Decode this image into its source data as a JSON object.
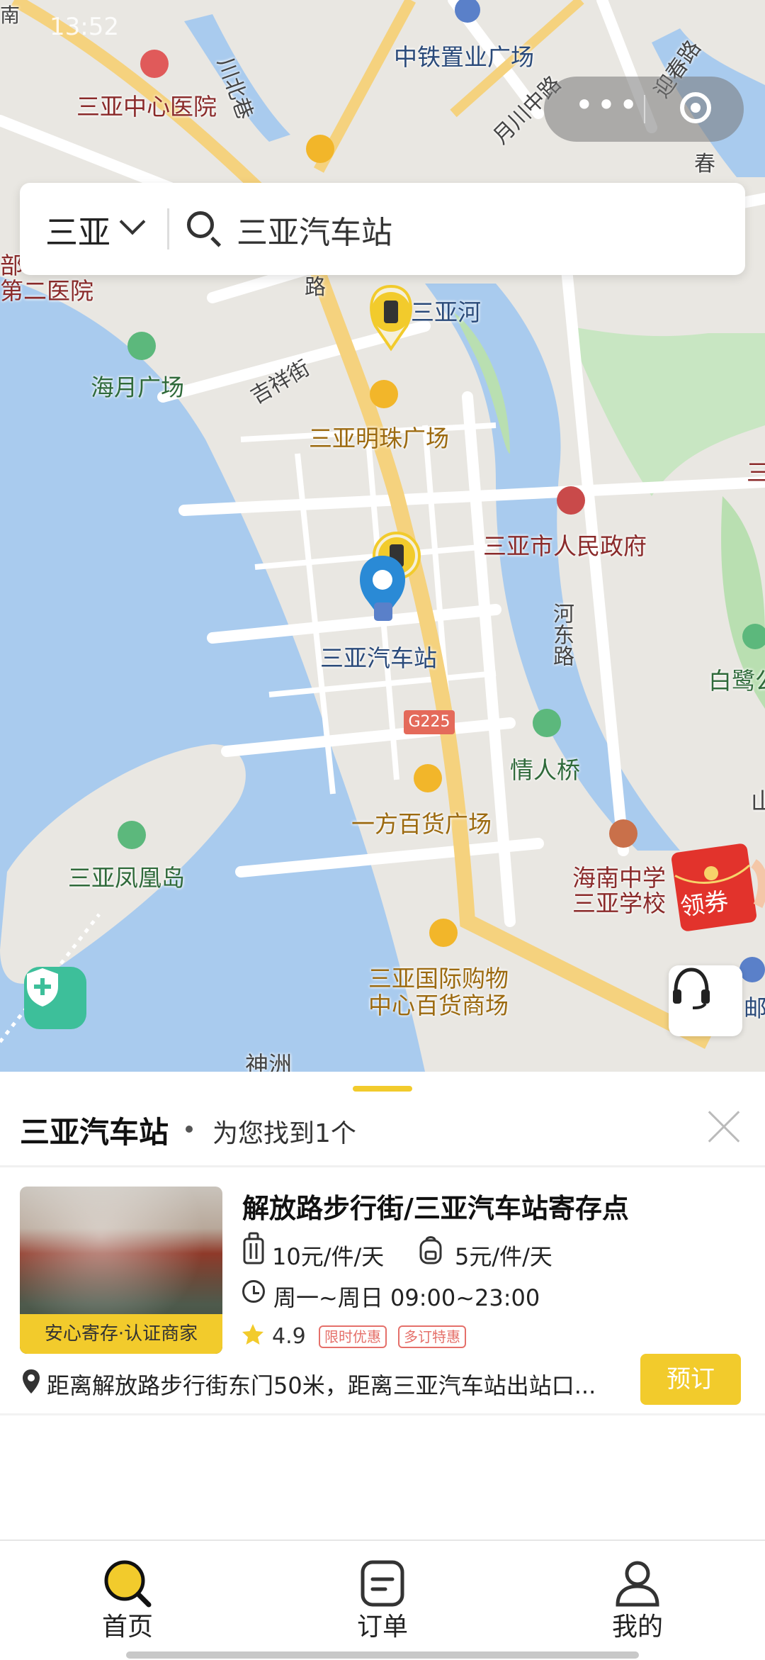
{
  "status_bar": {
    "time": "13:52"
  },
  "mini_program": {
    "more_label": "•••"
  },
  "search": {
    "city": "三亚",
    "query": "三亚汽车站"
  },
  "map": {
    "labels": {
      "zhongtie": "中铁置业广场",
      "hospital_center": "三亚中心医院",
      "hospital_second_a": "部",
      "hospital_second_b": "第二医院",
      "chuanbei": "川北巷",
      "yuechuan": "月川中路",
      "yingchun": "迎春路",
      "chun": "春",
      "sanya_river": "三亚河",
      "haiyue": "海月广场",
      "jixiang": "吉祥街",
      "lu": "路",
      "mingzhu": "三亚明珠广场",
      "gov": "三亚市人民政府",
      "bus_station": "三亚汽车站",
      "hedong": "河东路",
      "bailu": "白鹭公",
      "qingren": "情人桥",
      "yifang": "一方百货广场",
      "fenghuang": "三亚凤凰岛",
      "hainan_school_a": "海南中学",
      "hainan_school_b": "三亚学校",
      "intl_a": "三亚国际购物",
      "intl_b": "中心百货商场",
      "shenzhou": "神洲",
      "san": "三",
      "shan": "山",
      "you": "邮",
      "nan": "南",
      "g225": "G225"
    },
    "coupon_label": "领券"
  },
  "results": {
    "title": "三亚汽车站",
    "subtitle": "为您找到1个",
    "items": [
      {
        "name": "解放路步行街/三亚汽车站寄存点",
        "badge": "安心寄存·认证商家",
        "price_luggage": "10元/件/天",
        "price_bag": "5元/件/天",
        "hours": "周一~周日 09:00~23:00",
        "rating": "4.9",
        "tags": [
          "限时优惠",
          "多订特惠"
        ],
        "address": "距离解放路步行街东门50米，距离三亚汽车站出站口...",
        "book_label": "预订"
      }
    ]
  },
  "tabbar": {
    "home": "首页",
    "orders": "订单",
    "mine": "我的"
  },
  "colors": {
    "accent": "#f2cb2c",
    "water": "#a9cbee",
    "road": "#f5d27e"
  }
}
